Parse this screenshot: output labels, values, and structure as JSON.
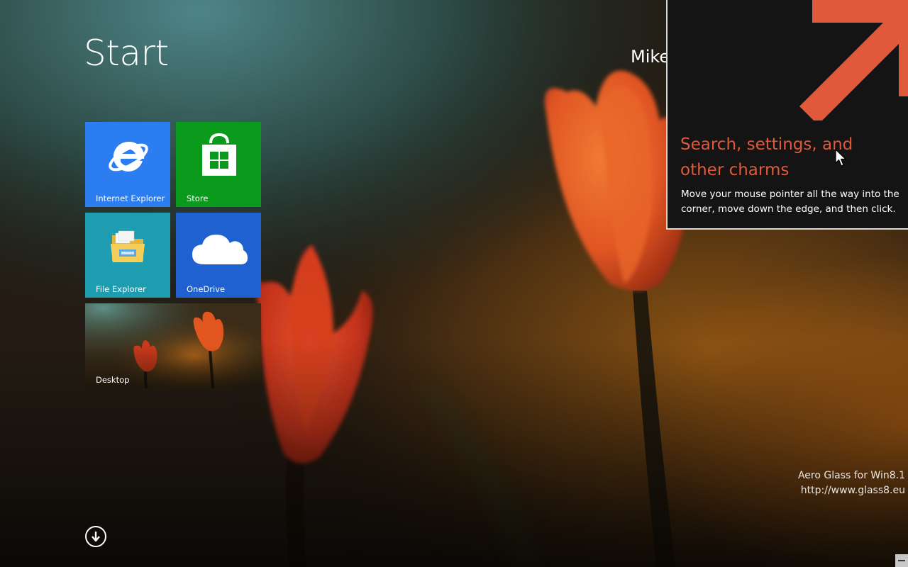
{
  "start": {
    "title": "Start",
    "user_name": "Mike"
  },
  "tiles": [
    {
      "label": "Internet Explorer",
      "color": "#2b7df0",
      "icon": "internet-explorer-icon"
    },
    {
      "label": "Store",
      "color": "#0a9b1c",
      "icon": "store-icon"
    },
    {
      "label": "File Explorer",
      "color": "#1f9db0",
      "icon": "file-explorer-icon"
    },
    {
      "label": "OneDrive",
      "color": "#1e61cf",
      "icon": "onedrive-icon"
    },
    {
      "label": "Desktop",
      "color": "#3a2d1c",
      "icon": "desktop-wallpaper-preview"
    }
  ],
  "all_apps": {
    "icon": "arrow-down-circle-icon"
  },
  "charm_tip": {
    "heading": "Search, settings, and other charms",
    "description": "Move your mouse pointer all the way into the corner, move down the edge, and then click.",
    "accent_color": "#e0593a",
    "arrow_icon": "arrow-up-right-icon"
  },
  "watermark": {
    "line1": "Aero Glass for Win8.1",
    "line2": "http://www.glass8.eu"
  }
}
